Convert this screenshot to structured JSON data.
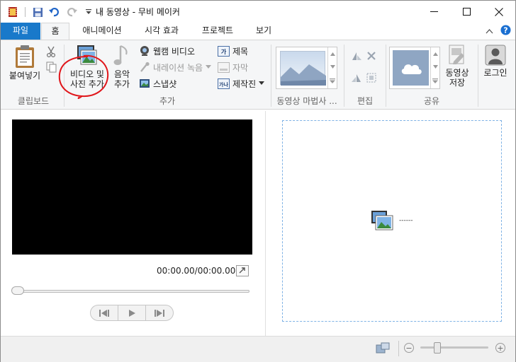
{
  "window": {
    "title": "내 동영상 - 무비 메이커",
    "controls": [
      "minimize-icon",
      "maximize-icon",
      "close-icon"
    ]
  },
  "tabs": [
    {
      "label": "파일"
    },
    {
      "label": "홈"
    },
    {
      "label": "애니메이션"
    },
    {
      "label": "시각 효과"
    },
    {
      "label": "프로젝트"
    },
    {
      "label": "보기"
    }
  ],
  "ribbon": {
    "clipboard": {
      "paste_label": "붙여넣기",
      "group_label": "클립보드"
    },
    "add": {
      "add_media_line1": "비디오 및",
      "add_media_line2": "사진 추가",
      "music_line1": "음악",
      "music_line2": "추가",
      "webcam": "웹캠 비디오",
      "narration": "내레이션 녹음",
      "snapshot": "스냅샷",
      "title": "제목",
      "caption": "자막",
      "credits": "제작진",
      "group_label": "추가"
    },
    "theme": {
      "group_label": "동영상 마법사 ..."
    },
    "edit": {
      "group_label": "편집"
    },
    "share": {
      "save_line1": "동영상",
      "save_line2": "저장",
      "group_label": "공유"
    },
    "login": {
      "label": "로그인"
    }
  },
  "player": {
    "timecode": "00:00.00/00:00.00",
    "seek_position": 0
  },
  "storyboard": {
    "hint": "------"
  },
  "statusbar": {
    "zoom_minus": "−",
    "zoom_plus": "+",
    "zoom_level": 0.25
  },
  "colors": {
    "accent": "#1979ca",
    "annotation": "#e0161b"
  }
}
